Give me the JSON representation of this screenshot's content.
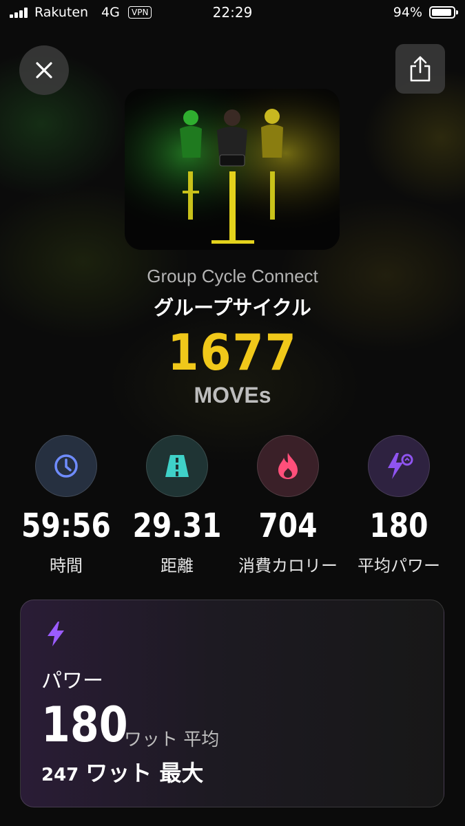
{
  "status_bar": {
    "carrier": "Rakuten",
    "network": "4G",
    "vpn": "VPN",
    "time": "22:29",
    "battery": "94%"
  },
  "header": {
    "close_icon": "close-icon",
    "share_icon": "share-icon"
  },
  "workout": {
    "subtitle": "Group Cycle Connect",
    "title": "グループサイクル",
    "moves_value": "1677",
    "moves_label": "MOVEs",
    "accent_color": "#f0c81a"
  },
  "stats": [
    {
      "icon": "clock-icon",
      "value": "59:56",
      "label": "時間",
      "color": "#6f8cff"
    },
    {
      "icon": "road-icon",
      "value": "29.31",
      "label": "距離",
      "color": "#3fd1c8"
    },
    {
      "icon": "flame-icon",
      "value": "704",
      "label": "消費カロリー",
      "color": "#ff4f7a"
    },
    {
      "icon": "bolt-gauge-icon",
      "value": "180",
      "label": "平均パワー",
      "color": "#8f54f0"
    }
  ],
  "power_card": {
    "icon": "bolt-icon",
    "title": "パワー",
    "avg_value": "180",
    "avg_unit": "ワット 平均",
    "max_value": "247",
    "max_unit": "ワット 最大"
  }
}
